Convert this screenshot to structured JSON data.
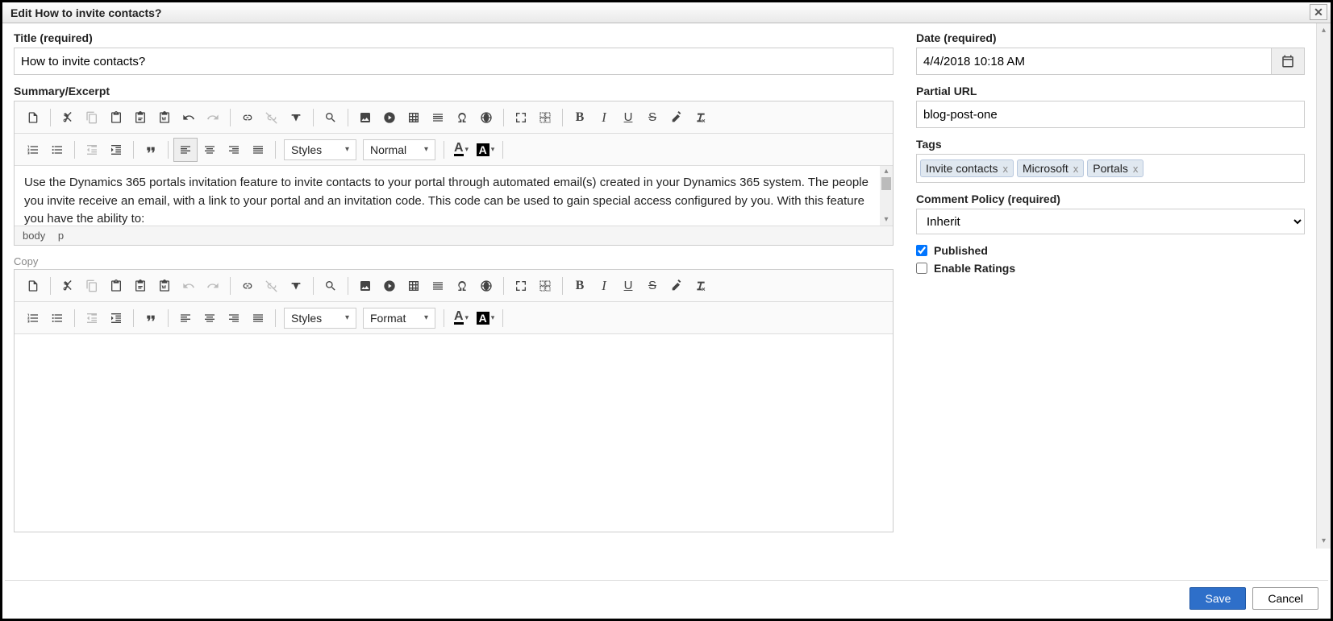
{
  "header": {
    "title": "Edit How to invite contacts?"
  },
  "left": {
    "title_label": "Title (required)",
    "title_value": "How to invite contacts?",
    "summary_label": "Summary/Excerpt",
    "summary_body": "Use the Dynamics 365 portals invitation feature to invite contacts to your portal through automated email(s) created in your Dynamics 365 system. The people you invite receive an email, with a link to your portal and an invitation code. This code can be used to gain special access configured by you. With this feature you have the ability to:",
    "summary_footer_body": "body",
    "summary_footer_p": "p",
    "copy_label": "Copy",
    "toolbar": {
      "styles": "Styles",
      "normal": "Normal",
      "format": "Format"
    }
  },
  "right": {
    "date_label": "Date (required)",
    "date_value": "4/4/2018 10:18 AM",
    "partial_url_label": "Partial URL",
    "partial_url_value": "blog-post-one",
    "tags_label": "Tags",
    "tags": [
      "Invite contacts",
      "Microsoft",
      "Portals"
    ],
    "comment_policy_label": "Comment Policy (required)",
    "comment_policy_value": "Inherit",
    "published_label": "Published",
    "enable_ratings_label": "Enable Ratings"
  },
  "footer": {
    "save": "Save",
    "cancel": "Cancel"
  }
}
